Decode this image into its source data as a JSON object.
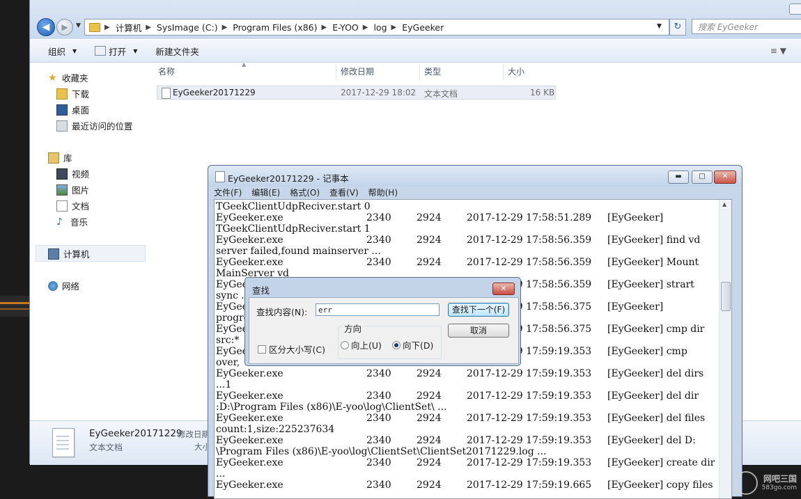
{
  "explorer": {
    "breadcrumb": [
      "计算机",
      "SysImage (C:)",
      "Program Files (x86)",
      "E-YOO",
      "log",
      "EyGeeker"
    ],
    "search_placeholder": "搜索 EyGeeker",
    "commands": {
      "organize": "组织",
      "open": "打开",
      "new_folder": "新建文件夹"
    },
    "nav": {
      "favorites": "收藏夹",
      "downloads": "下载",
      "desktop": "桌面",
      "recent": "最近访问的位置",
      "libraries": "库",
      "videos": "视频",
      "pictures": "图片",
      "documents": "文档",
      "music": "音乐",
      "computer": "计算机",
      "network": "网络"
    },
    "columns": {
      "name": "名称",
      "modified": "修改日期",
      "type": "类型",
      "size": "大小"
    },
    "file": {
      "name": "EyGeeker20171229",
      "modified": "2017-12-29 18:02",
      "type": "文本文档",
      "size": "16 KB"
    },
    "details": {
      "name": "EyGeeker20171229",
      "modified_label": "修改日期",
      "type": "文本文档",
      "size_label": "大小"
    }
  },
  "notepad": {
    "title": "EyGeeker20171229 - 记事本",
    "menu": [
      "文件(F)",
      "编辑(E)",
      "格式(O)",
      "查看(V)",
      "帮助(H)"
    ],
    "lines": [
      {
        "cols": [
          "TGeekClientUdpReciver.start 0"
        ]
      },
      {
        "cols": [
          "EyGeeker.exe",
          "2340",
          "2924",
          "2017-12-29 17:58:51.289",
          "[EyGeeker]"
        ]
      },
      {
        "cols": [
          "TGeekClientUdpReciver.start 1"
        ]
      },
      {
        "cols": [
          "EyGeeker.exe",
          "2340",
          "2924",
          "2017-12-29 17:58:56.359",
          "[EyGeeker] find vd"
        ]
      },
      {
        "cols": [
          "server failed,found mainserver ..."
        ]
      },
      {
        "cols": [
          "EyGeeker.exe",
          "2340",
          "2924",
          "2017-12-29 17:58:56.359",
          "[EyGeeker] Mount"
        ]
      },
      {
        "cols": [
          "MainServer vd"
        ]
      },
      {
        "cols": [
          "EyGeeker.exe",
          "",
          "",
          "2017-12-29 17:58:56.359",
          "[EyGeeker] strart"
        ]
      },
      {
        "cols": [
          "sync ..."
        ]
      },
      {
        "cols": [
          "EyGeeker.exe",
          "",
          "",
          "2017-12-29 17:58:56.375",
          "[EyGeeker]"
        ]
      },
      {
        "cols": [
          "progress"
        ]
      },
      {
        "cols": [
          "EyGeeker.exe",
          "",
          "",
          "2017-12-29 17:58:56.375",
          "[EyGeeker] cmp dir"
        ]
      },
      {
        "cols": [
          "src:*"
        ]
      },
      {
        "cols": [
          "EyGeeker.exe",
          "",
          "",
          "2017-12-29 17:59:19.353",
          "[EyGeeker] cmp"
        ]
      },
      {
        "cols": [
          "over,"
        ]
      },
      {
        "cols": [
          "EyGeeker.exe",
          "2340",
          "2924",
          "2017-12-29 17:59:19.353",
          "[EyGeeker] del dirs"
        ]
      },
      {
        "cols": [
          "...1"
        ]
      },
      {
        "cols": [
          "EyGeeker.exe",
          "2340",
          "2924",
          "2017-12-29 17:59:19.353",
          "[EyGeeker] del dir"
        ]
      },
      {
        "cols": [
          ":D:\\Program Files (x86)\\E-yoo\\log\\ClientSet\\ ..."
        ]
      },
      {
        "cols": [
          "EyGeeker.exe",
          "2340",
          "2924",
          "2017-12-29 17:59:19.353",
          "[EyGeeker] del files"
        ]
      },
      {
        "cols": [
          "count:1,size:225237634"
        ]
      },
      {
        "cols": [
          "EyGeeker.exe",
          "2340",
          "2924",
          "2017-12-29 17:59:19.353",
          "[EyGeeker] del D:"
        ]
      },
      {
        "cols": [
          "\\Program Files (x86)\\E-yoo\\log\\ClientSet\\ClientSet20171229.log ..."
        ]
      },
      {
        "cols": [
          "EyGeeker.exe",
          "2340",
          "2924",
          "2017-12-29 17:59:19.353",
          "[EyGeeker] create dir"
        ]
      },
      {
        "cols": [
          "..."
        ]
      },
      {
        "cols": [
          "EyGeeker.exe",
          "2340",
          "2924",
          "2017-12-29 17:59:19.665",
          "[EyGeeker] copy files"
        ]
      }
    ]
  },
  "find_dialog": {
    "title": "查找",
    "find_what_label": "查找内容(N):",
    "find_what_value": "err",
    "find_next_label": "查找下一个(F)",
    "cancel_label": "取消",
    "direction_label": "方向",
    "up_label": "向上(U)",
    "down_label": "向下(D)",
    "match_case_label": "区分大小写(C)",
    "direction_selected": "down",
    "match_case": false
  },
  "watermark": {
    "line1": "网吧三国",
    "line2": "583go.com"
  },
  "colors": {
    "accent": "#3c7fb1",
    "close_red": "#c84e40",
    "title_blue": "#c7d6e8"
  }
}
